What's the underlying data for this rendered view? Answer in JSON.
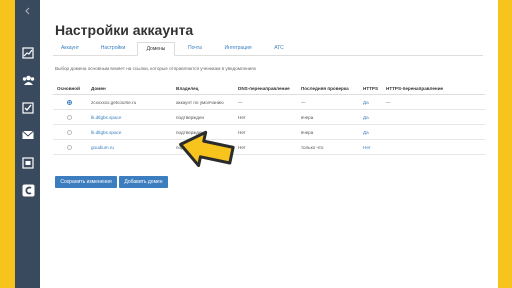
{
  "page": {
    "title": "Настройки аккаунта"
  },
  "tabs": [
    {
      "label": "Аккаунт",
      "active": false
    },
    {
      "label": "Настройки",
      "active": false
    },
    {
      "label": "Домены",
      "active": true
    },
    {
      "label": "Почта",
      "active": false
    },
    {
      "label": "Интеграция",
      "active": false
    },
    {
      "label": "АТС",
      "active": false
    }
  ],
  "hint": "Выбор домена основным влияет на ссылки, которые отправляются ученикам в уведомлениях",
  "table": {
    "headers": [
      "Основной",
      "Домен",
      "Владелец",
      "DNS-перенаправление",
      "Последняя проверка",
      "HTTPS",
      "HTTPS-перенаправление"
    ],
    "rows": [
      {
        "primary": true,
        "domain": "zcxxxxxx.getcourse.ru",
        "owner": "аккаунт по умолчанию",
        "dns": "—",
        "checked": "—",
        "https": "Да",
        "https_redirect": "—"
      },
      {
        "primary": false,
        "domain": "lk.dtlgbs.space",
        "owner": "подтвержден",
        "dns": "Нет",
        "checked": "вчера",
        "https": "Да",
        "https_redirect": ""
      },
      {
        "primary": false,
        "domain": "lk.dtlgbs.space",
        "owner": "подтвержден",
        "dns": "Нет",
        "checked": "вчера",
        "https": "Да",
        "https_redirect": ""
      },
      {
        "primary": false,
        "domain": "goudium.ru",
        "owner": "подтвержден",
        "dns": "Нет",
        "checked": "только что",
        "https": "Нет",
        "https_redirect": ""
      }
    ]
  },
  "buttons": {
    "save": "Сохранить изменения",
    "add_domain": "Добавить домен"
  },
  "sidebar_icons": [
    "collapse-icon",
    "chart-icon",
    "users-icon",
    "tasks-icon",
    "mail-icon",
    "video-icon",
    "getcourse-logo-icon"
  ],
  "colors": {
    "accent": "#3b7dbf",
    "sidebar": "#3a4a5e",
    "frame": "#f7c31d",
    "arrow": "#f7c31d"
  }
}
